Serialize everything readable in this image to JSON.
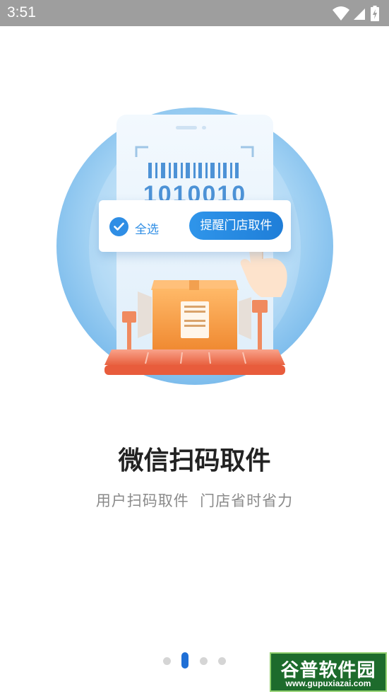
{
  "status_bar": {
    "time": "3:51",
    "icons": [
      "wifi-icon",
      "signal-icon",
      "battery-charging-icon"
    ]
  },
  "illustration": {
    "barcode_number": "1010010",
    "select_all_label": "全选",
    "remind_button_label": "提醒门店取件"
  },
  "onboarding": {
    "title": "微信扫码取件",
    "subtitle": "用户扫码取件  门店省时省力",
    "page_indicator": {
      "total": 4,
      "active_index": 1
    }
  },
  "watermark": {
    "logo_text": "谷普软件园",
    "url": "www.gupuxiazai.com"
  },
  "colors": {
    "accent": "#2f8ee5",
    "status_bar": "#9e9e9e",
    "title": "#222222",
    "subtitle": "#8a8a8a",
    "box": "#f7a04a",
    "conveyor": "#f2775a"
  }
}
